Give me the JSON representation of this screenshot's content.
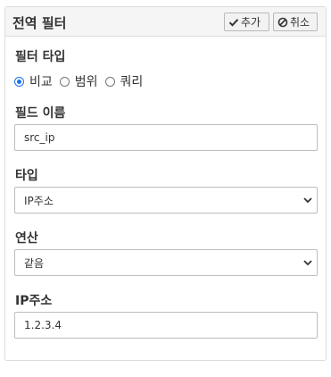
{
  "panel": {
    "title": "전역 필터",
    "add_label": "추가",
    "cancel_label": "취소"
  },
  "filter_type": {
    "label": "필터 타입",
    "options": [
      "비교",
      "범위",
      "쿼리"
    ],
    "selected": "비교"
  },
  "field_name": {
    "label": "필드 이름",
    "value": "src_ip"
  },
  "type": {
    "label": "타입",
    "value": "IP주소"
  },
  "operation": {
    "label": "연산",
    "value": "같음"
  },
  "ip_address": {
    "label": "IP주소",
    "value": "1.2.3.4"
  },
  "colors": {
    "accent": "#1a73e8",
    "border": "#dcdcdc",
    "header_bg": "#f5f5f5"
  },
  "icons": {
    "add": "check-icon",
    "cancel": "ban-icon",
    "select": "chevron-down-icon"
  }
}
